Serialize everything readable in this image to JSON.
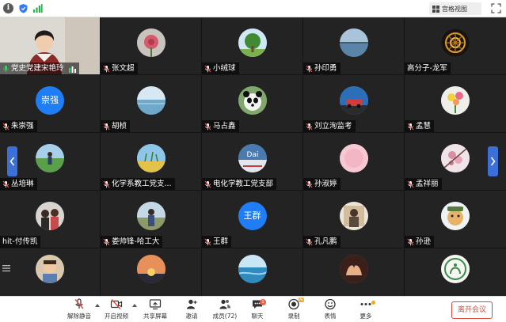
{
  "topbar": {
    "view_label": "宫格视图"
  },
  "participants": [
    {
      "name": "党史党建宋艳玲",
      "mic": "on",
      "avatar": "camera"
    },
    {
      "name": "张文超",
      "mic": "off",
      "avatar": "rose"
    },
    {
      "name": "小绒球",
      "mic": "off",
      "avatar": "tree"
    },
    {
      "name": "孙印勇",
      "mic": "off",
      "avatar": "lake"
    },
    {
      "name": "高分子-龙军",
      "mic": "none",
      "avatar": "molecule"
    },
    {
      "name": "朱崇强",
      "mic": "off",
      "avatar": "text",
      "avatar_text": "崇强"
    },
    {
      "name": "胡桢",
      "mic": "off",
      "avatar": "sea"
    },
    {
      "name": "马占鑫",
      "mic": "off",
      "avatar": "panda"
    },
    {
      "name": "刘立洵监考",
      "mic": "off",
      "avatar": "car"
    },
    {
      "name": "孟慧",
      "mic": "off",
      "avatar": "flowers"
    },
    {
      "name": "丛培琳",
      "mic": "off",
      "avatar": "person-field"
    },
    {
      "name": "化学系教工党支...",
      "mic": "off",
      "avatar": "field"
    },
    {
      "name": "电化学教工党支部",
      "mic": "off",
      "avatar": "dai",
      "avatar_text": "Dai"
    },
    {
      "name": "孙淑婷",
      "mic": "off",
      "avatar": "pink"
    },
    {
      "name": "孟祥丽",
      "mic": "off",
      "avatar": "blossom"
    },
    {
      "name": "hit-付传凯",
      "mic": "none",
      "avatar": "couple"
    },
    {
      "name": "娄帅锋-哈工大",
      "mic": "off",
      "avatar": "outdoor"
    },
    {
      "name": "王群",
      "mic": "off",
      "avatar": "text",
      "avatar_text": "王群"
    },
    {
      "name": "孔凡鹏",
      "mic": "off",
      "avatar": "portrait"
    },
    {
      "name": "孙逊",
      "mic": "off",
      "avatar": "cartoon"
    },
    {
      "name": "",
      "mic": "none",
      "avatar": "child"
    },
    {
      "name": "",
      "mic": "none",
      "avatar": "sunset"
    },
    {
      "name": "",
      "mic": "none",
      "avatar": "coast"
    },
    {
      "name": "",
      "mic": "none",
      "avatar": "hands"
    },
    {
      "name": "",
      "mic": "none",
      "avatar": "logo"
    }
  ],
  "toolbar": {
    "mute": "解除静音",
    "video": "开启视频",
    "share": "共享屏幕",
    "invite": "邀请",
    "members": "成员(72)",
    "chat": "聊天",
    "chat_badge": "1",
    "record": "录制",
    "record_badge": "AI",
    "reactions": "表情",
    "more": "更多",
    "leave": "离开会议"
  },
  "colors": {
    "tile_bg": "#232323",
    "accent_blue": "#3d6fd8",
    "leave_red": "#e0483a",
    "muted_red": "#e5483c"
  }
}
